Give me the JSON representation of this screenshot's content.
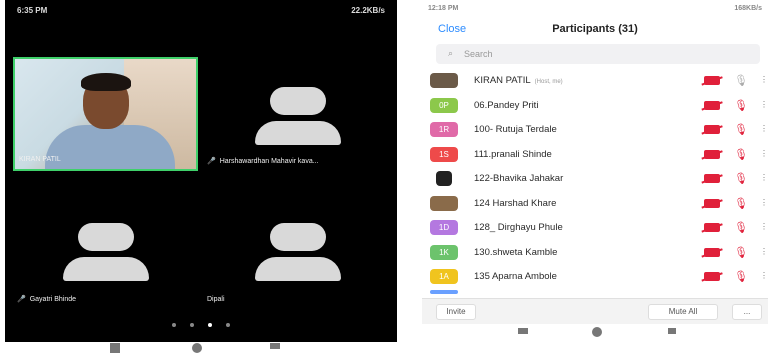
{
  "left_screen": {
    "status_time": "6:35 PM",
    "status_right": "22.2KB/s",
    "tiles": [
      {
        "label": "KIRAN PATIL",
        "type": "video"
      },
      {
        "label": "Harshawardhan Mahavir kava...",
        "type": "avatar"
      },
      {
        "label": "Gayatri Bhinde",
        "type": "avatar"
      },
      {
        "label": "Dipali",
        "type": "avatar"
      }
    ],
    "pager_dots": 4,
    "active_dot": 2
  },
  "right_screen": {
    "status_time": "12:18 PM",
    "status_right": "168KB/s",
    "close_label": "Close",
    "title": "Participants (31)",
    "search_placeholder": "Search",
    "participants": [
      {
        "badge": "",
        "badge_color": "#6b5a48",
        "name": "KIRAN PATIL",
        "sub": "(Host, me)",
        "mic_muted": false
      },
      {
        "badge": "0P",
        "badge_color": "#8cc84b",
        "name": "06.Pandey Priti",
        "sub": "",
        "mic_muted": true
      },
      {
        "badge": "1R",
        "badge_color": "#e06aa8",
        "name": "100- Rutuja Terdale",
        "sub": "",
        "mic_muted": true
      },
      {
        "badge": "1S",
        "badge_color": "#ee4a4a",
        "name": "111.pranali Shinde",
        "sub": "",
        "mic_muted": true
      },
      {
        "badge": "",
        "badge_color": "#222222",
        "name": "122-Bhavika Jahakar",
        "sub": "",
        "mic_muted": true
      },
      {
        "badge": "",
        "badge_color": "#8a6b4a",
        "name": "124 Harshad Khare",
        "sub": "",
        "mic_muted": true
      },
      {
        "badge": "1D",
        "badge_color": "#b478e0",
        "name": "128_ Dirghayu Phule",
        "sub": "",
        "mic_muted": true
      },
      {
        "badge": "1K",
        "badge_color": "#6cc36c",
        "name": "130.shweta Kamble",
        "sub": "",
        "mic_muted": true
      },
      {
        "badge": "1A",
        "badge_color": "#f0c41e",
        "name": "135 Aparna Ambole",
        "sub": "",
        "mic_muted": true
      }
    ],
    "invite_label": "Invite",
    "mute_all_label": "Mute All",
    "more_label": "..."
  }
}
